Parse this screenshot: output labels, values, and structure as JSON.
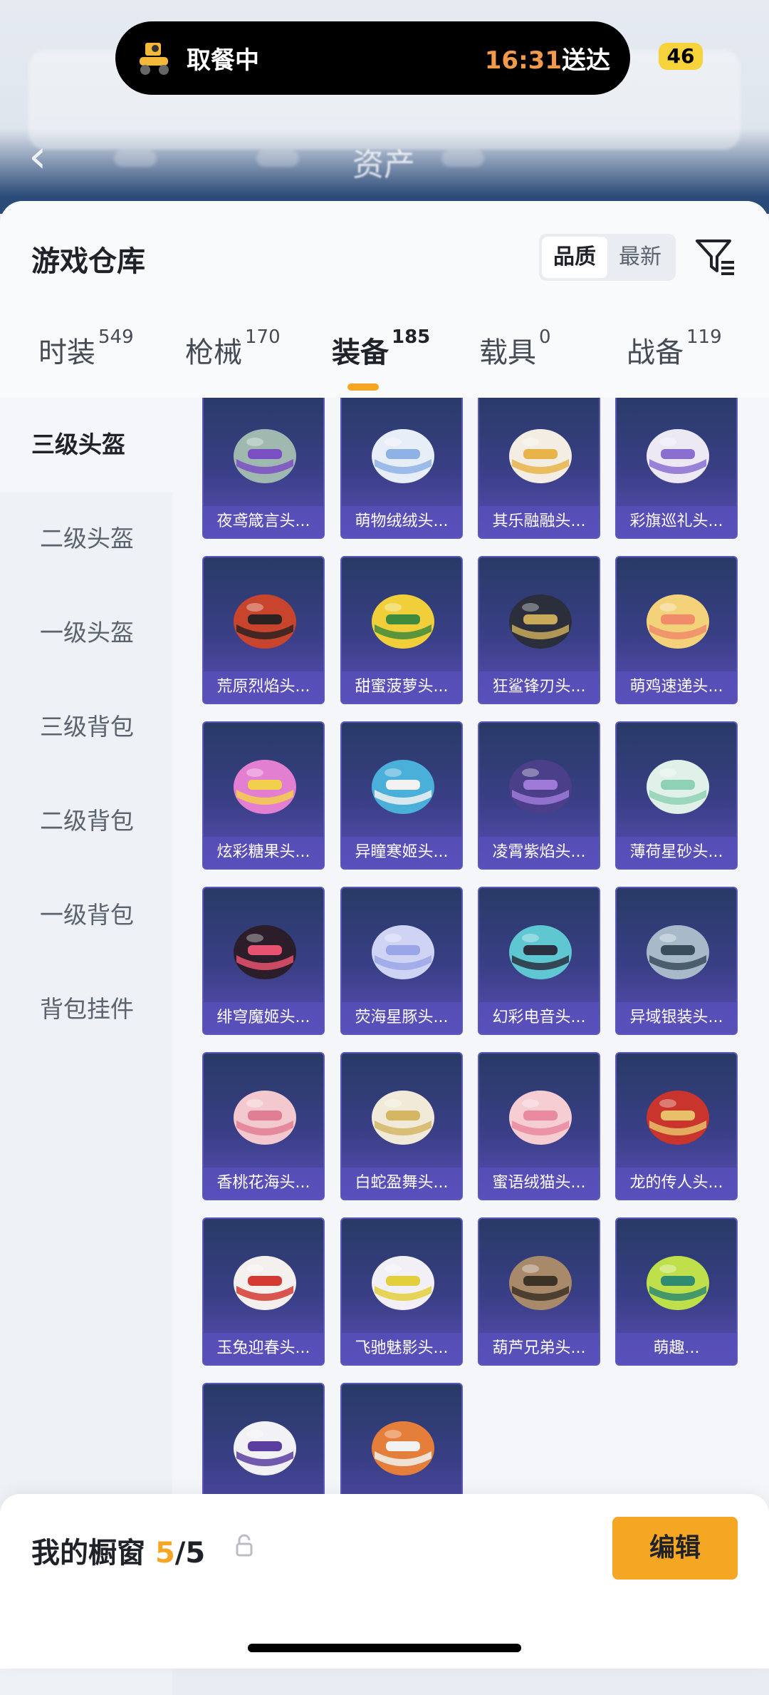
{
  "status_bar": {
    "delivery_status": "取餐中",
    "eta_time": "16:31",
    "eta_suffix": "送达",
    "battery": "46"
  },
  "background": {
    "title": "资产"
  },
  "header": {
    "title": "游戏仓库",
    "sort_options": [
      "品质",
      "最新"
    ],
    "sort_selected": "品质"
  },
  "tabs": [
    {
      "label": "时装",
      "count": "549"
    },
    {
      "label": "枪械",
      "count": "170"
    },
    {
      "label": "装备",
      "count": "185"
    },
    {
      "label": "载具",
      "count": "0"
    },
    {
      "label": "战备",
      "count": "119"
    }
  ],
  "active_tab": "装备",
  "sidebar": {
    "items": [
      "三级头盔",
      "二级头盔",
      "一级头盔",
      "三级背包",
      "二级背包",
      "一级背包",
      "背包挂件"
    ],
    "active": "三级头盔"
  },
  "items": [
    {
      "name": "夜鸢箴言头...",
      "color": "#9fb9b0",
      "accent": "#7b4fc4"
    },
    {
      "name": "萌物绒绒头...",
      "color": "#e8eef8",
      "accent": "#8fb2e6"
    },
    {
      "name": "其乐融融头...",
      "color": "#f3ede3",
      "accent": "#e8b44a"
    },
    {
      "name": "彩旗巡礼头...",
      "color": "#ece8f4",
      "accent": "#8a6fd1"
    },
    {
      "name": "荒原烈焰头...",
      "color": "#c8442c",
      "accent": "#2d2222"
    },
    {
      "name": "甜蜜菠萝头...",
      "color": "#f0cf3a",
      "accent": "#3f8a3c"
    },
    {
      "name": "狂鲨锋刃头...",
      "color": "#2b2f3b",
      "accent": "#c9a95a"
    },
    {
      "name": "萌鸡速递头...",
      "color": "#f4d27a",
      "accent": "#f08c6a"
    },
    {
      "name": "炫彩糖果头...",
      "color": "#e37fd1",
      "accent": "#f3d04c"
    },
    {
      "name": "异瞳寒姬头...",
      "color": "#4ab0d9",
      "accent": "#f2f2f2"
    },
    {
      "name": "凌霄紫焰头...",
      "color": "#4c3f8a",
      "accent": "#9f7ad9"
    },
    {
      "name": "薄荷星砂头...",
      "color": "#dff1e8",
      "accent": "#8fd1b5"
    },
    {
      "name": "绯穹魔姬头...",
      "color": "#2b1d29",
      "accent": "#e6526f"
    },
    {
      "name": "荧海星豚头...",
      "color": "#cfd4f4",
      "accent": "#9aa6e8"
    },
    {
      "name": "幻彩电音头...",
      "color": "#5fc7d2",
      "accent": "#2b2f40"
    },
    {
      "name": "异域银装头...",
      "color": "#a8bac9",
      "accent": "#3a4d5f"
    },
    {
      "name": "香桃花海头...",
      "color": "#f3c9cf",
      "accent": "#e07f93"
    },
    {
      "name": "白蛇盈舞头...",
      "color": "#f1ead8",
      "accent": "#d4b665"
    },
    {
      "name": "蜜语绒猫头...",
      "color": "#f5cdd3",
      "accent": "#e98aa0"
    },
    {
      "name": "龙的传人头...",
      "color": "#c9352c",
      "accent": "#e8c06a"
    },
    {
      "name": "玉兔迎春头...",
      "color": "#f4f0ee",
      "accent": "#d33a33"
    },
    {
      "name": "飞驰魅影头...",
      "color": "#f2f0f6",
      "accent": "#e3cf3b"
    },
    {
      "name": "葫芦兄弟头...",
      "color": "#a8896a",
      "accent": "#3d3226"
    },
    {
      "name": "萌趣...",
      "color": "#bfe04a",
      "accent": "#2f8c6e"
    },
    {
      "name": "",
      "color": "#f2f2f6",
      "accent": "#5a3fa0"
    },
    {
      "name": "",
      "color": "#e57e3a",
      "accent": "#f2f2f2"
    }
  ],
  "bottom": {
    "label": "我的橱窗",
    "count": "5",
    "total": "/5",
    "edit": "编辑"
  }
}
